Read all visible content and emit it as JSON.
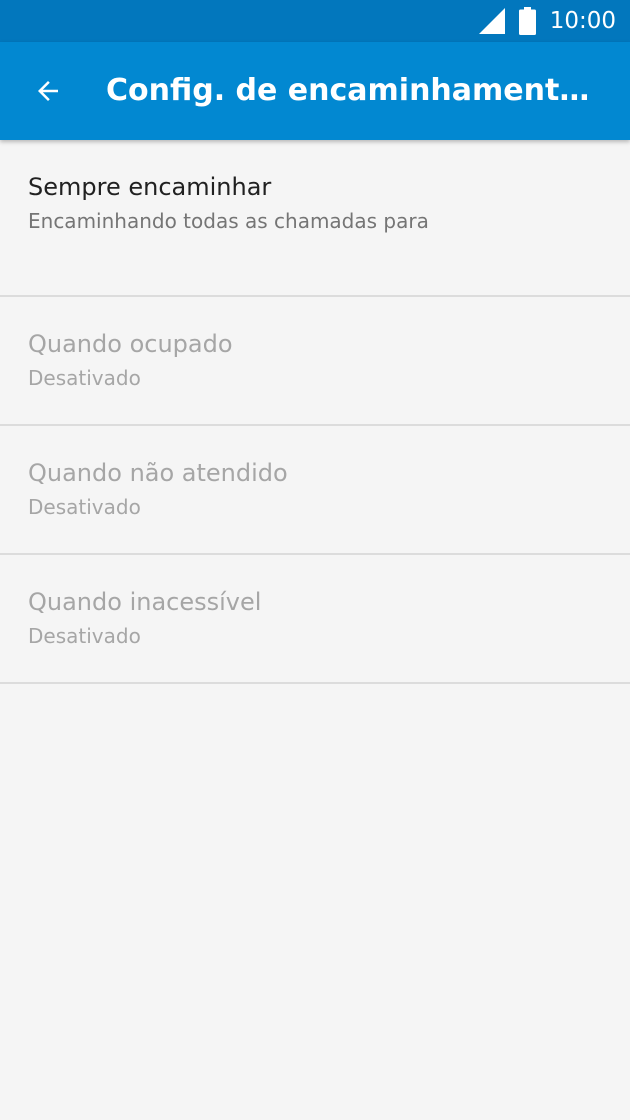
{
  "status_bar": {
    "time": "10:00",
    "icons": [
      "signal-icon",
      "battery-icon"
    ]
  },
  "app_bar": {
    "title": "Config. de encaminhamento…",
    "back_icon": "arrow-back-icon"
  },
  "colors": {
    "status_bar": "#0277bd",
    "app_bar": "#0288d1",
    "background": "#f5f5f5",
    "divider": "#dcdcdc"
  },
  "settings": [
    {
      "title": "Sempre encaminhar",
      "summary": "Encaminhando todas as chamadas para",
      "enabled": true
    },
    {
      "title": "Quando ocupado",
      "summary": "Desativado",
      "enabled": false
    },
    {
      "title": "Quando não atendido",
      "summary": "Desativado",
      "enabled": false
    },
    {
      "title": "Quando inacessível",
      "summary": "Desativado",
      "enabled": false
    }
  ]
}
